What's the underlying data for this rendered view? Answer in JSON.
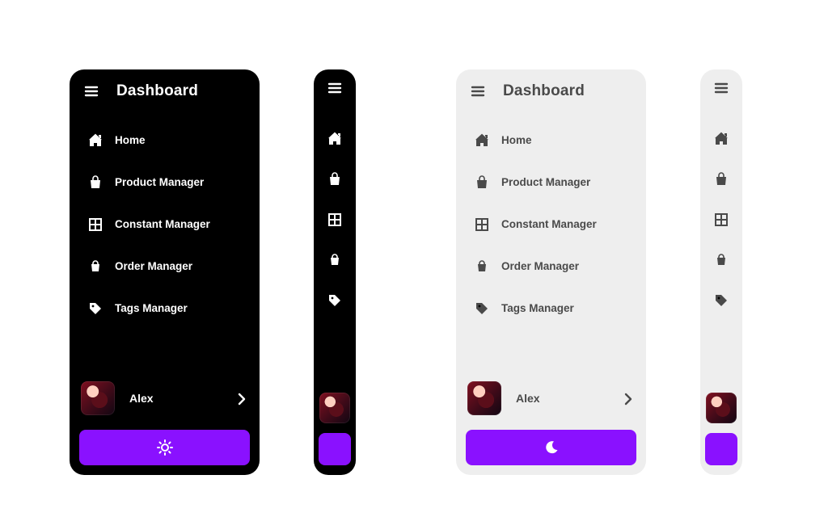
{
  "title": "Dashboard",
  "nav": {
    "items": [
      {
        "label": "Home",
        "icon": "home-icon"
      },
      {
        "label": "Product Manager",
        "icon": "bag-icon"
      },
      {
        "label": "Constant Manager",
        "icon": "grid-icon"
      },
      {
        "label": "Order Manager",
        "icon": "cart-icon"
      },
      {
        "label": "Tags Manager",
        "icon": "tag-icon"
      }
    ]
  },
  "user": {
    "name": "Alex"
  },
  "theme_button": {
    "dark_icon": "sun-icon",
    "light_icon": "moon-icon"
  },
  "colors": {
    "accent": "#8a11ff"
  }
}
